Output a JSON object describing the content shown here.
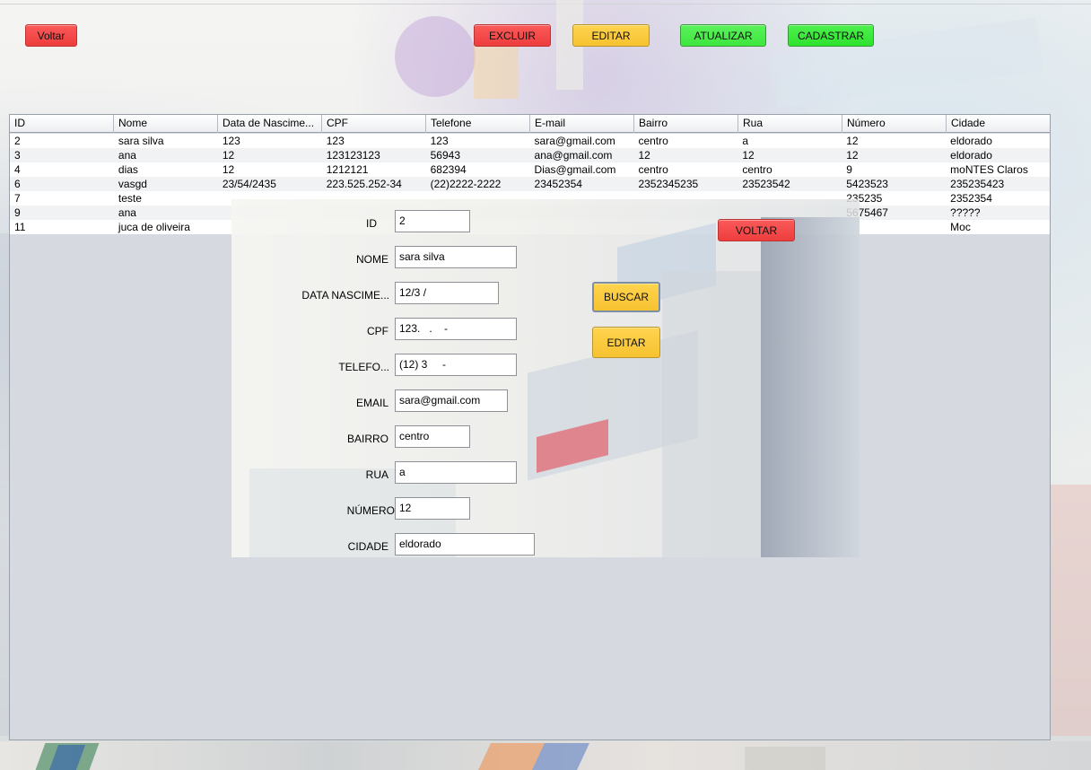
{
  "toolbar": {
    "voltar_label": "Voltar",
    "excluir_label": "EXCLUIR",
    "editar_label": "EDITAR",
    "atualizar_label": "ATUALIZAR",
    "cadastrar_label": "CADASTRAR"
  },
  "table": {
    "columns": [
      "ID",
      "Nome",
      "Data de Nascime...",
      "CPF",
      "Telefone",
      "E-mail",
      "Bairro",
      "Rua",
      "Número",
      "Cidade"
    ],
    "rows": [
      [
        "2",
        "sara silva",
        "123",
        "123",
        "123",
        "sara@gmail.com",
        "centro",
        "a",
        "12",
        "eldorado"
      ],
      [
        "3",
        "ana",
        "12",
        "123123123",
        "56943",
        "ana@gmail.com",
        "12",
        "12",
        "12",
        "eldorado"
      ],
      [
        "4",
        "dias",
        "12",
        "1212121",
        "682394",
        "Dias@gmail.com",
        "centro",
        "centro",
        "9",
        "moNTES Claros"
      ],
      [
        "6",
        "vasgd",
        "23/54/2435",
        "223.525.252-34",
        "(22)2222-2222",
        "23452354",
        "2352345235",
        "23523542",
        "5423523",
        "235235423"
      ],
      [
        "7",
        "teste",
        "",
        "",
        "",
        "",
        "",
        "",
        "235235",
        "2352354"
      ],
      [
        "9",
        "ana",
        "",
        "",
        "",
        "",
        "",
        "",
        "5675467",
        "?????"
      ],
      [
        "11",
        "juca de oliveira",
        "",
        "",
        "",
        "",
        "",
        "",
        "",
        "Moc"
      ]
    ]
  },
  "form": {
    "id_label": "ID",
    "id_value": "2",
    "nome_label": "NOME",
    "nome_value": "sara silva",
    "data_label": "DATA NASCIME...",
    "data_value": "12/3 /",
    "cpf_label": "CPF",
    "cpf_value": "123.   .    -",
    "telefone_label": "TELEFO...",
    "telefone_value": "(12) 3     -",
    "email_label": "EMAIL",
    "email_value": "sara@gmail.com",
    "bairro_label": "BAIRRO",
    "bairro_value": "centro",
    "rua_label": "RUA",
    "rua_value": "a",
    "numero_label": "NÚMERO",
    "numero_value": "12",
    "cidade_label": "CIDADE",
    "cidade_value": "eldorado",
    "voltar_label": "VOLTAR",
    "buscar_label": "BUSCAR",
    "editar_label": "EDITAR"
  },
  "colors": {
    "red_button": "#f04444",
    "yellow_button": "#f8c836",
    "green_button": "#44e844",
    "table_background": "#d6d9e0"
  }
}
